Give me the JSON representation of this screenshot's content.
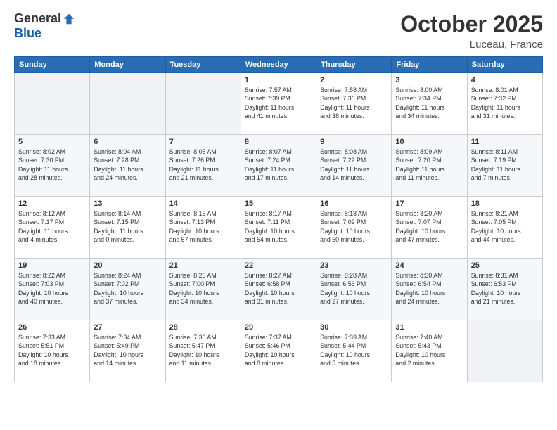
{
  "logo": {
    "general": "General",
    "blue": "Blue"
  },
  "title": "October 2025",
  "location": "Luceau, France",
  "headers": [
    "Sunday",
    "Monday",
    "Tuesday",
    "Wednesday",
    "Thursday",
    "Friday",
    "Saturday"
  ],
  "weeks": [
    [
      {
        "day": "",
        "content": ""
      },
      {
        "day": "",
        "content": ""
      },
      {
        "day": "",
        "content": ""
      },
      {
        "day": "1",
        "content": "Sunrise: 7:57 AM\nSunset: 7:39 PM\nDaylight: 11 hours\nand 41 minutes."
      },
      {
        "day": "2",
        "content": "Sunrise: 7:58 AM\nSunset: 7:36 PM\nDaylight: 11 hours\nand 38 minutes."
      },
      {
        "day": "3",
        "content": "Sunrise: 8:00 AM\nSunset: 7:34 PM\nDaylight: 11 hours\nand 34 minutes."
      },
      {
        "day": "4",
        "content": "Sunrise: 8:01 AM\nSunset: 7:32 PM\nDaylight: 11 hours\nand 31 minutes."
      }
    ],
    [
      {
        "day": "5",
        "content": "Sunrise: 8:02 AM\nSunset: 7:30 PM\nDaylight: 11 hours\nand 28 minutes."
      },
      {
        "day": "6",
        "content": "Sunrise: 8:04 AM\nSunset: 7:28 PM\nDaylight: 11 hours\nand 24 minutes."
      },
      {
        "day": "7",
        "content": "Sunrise: 8:05 AM\nSunset: 7:26 PM\nDaylight: 11 hours\nand 21 minutes."
      },
      {
        "day": "8",
        "content": "Sunrise: 8:07 AM\nSunset: 7:24 PM\nDaylight: 11 hours\nand 17 minutes."
      },
      {
        "day": "9",
        "content": "Sunrise: 8:08 AM\nSunset: 7:22 PM\nDaylight: 11 hours\nand 14 minutes."
      },
      {
        "day": "10",
        "content": "Sunrise: 8:09 AM\nSunset: 7:20 PM\nDaylight: 11 hours\nand 11 minutes."
      },
      {
        "day": "11",
        "content": "Sunrise: 8:11 AM\nSunset: 7:19 PM\nDaylight: 11 hours\nand 7 minutes."
      }
    ],
    [
      {
        "day": "12",
        "content": "Sunrise: 8:12 AM\nSunset: 7:17 PM\nDaylight: 11 hours\nand 4 minutes."
      },
      {
        "day": "13",
        "content": "Sunrise: 8:14 AM\nSunset: 7:15 PM\nDaylight: 11 hours\nand 0 minutes."
      },
      {
        "day": "14",
        "content": "Sunrise: 8:15 AM\nSunset: 7:13 PM\nDaylight: 10 hours\nand 57 minutes."
      },
      {
        "day": "15",
        "content": "Sunrise: 8:17 AM\nSunset: 7:11 PM\nDaylight: 10 hours\nand 54 minutes."
      },
      {
        "day": "16",
        "content": "Sunrise: 8:18 AM\nSunset: 7:09 PM\nDaylight: 10 hours\nand 50 minutes."
      },
      {
        "day": "17",
        "content": "Sunrise: 8:20 AM\nSunset: 7:07 PM\nDaylight: 10 hours\nand 47 minutes."
      },
      {
        "day": "18",
        "content": "Sunrise: 8:21 AM\nSunset: 7:05 PM\nDaylight: 10 hours\nand 44 minutes."
      }
    ],
    [
      {
        "day": "19",
        "content": "Sunrise: 8:22 AM\nSunset: 7:03 PM\nDaylight: 10 hours\nand 40 minutes."
      },
      {
        "day": "20",
        "content": "Sunrise: 8:24 AM\nSunset: 7:02 PM\nDaylight: 10 hours\nand 37 minutes."
      },
      {
        "day": "21",
        "content": "Sunrise: 8:25 AM\nSunset: 7:00 PM\nDaylight: 10 hours\nand 34 minutes."
      },
      {
        "day": "22",
        "content": "Sunrise: 8:27 AM\nSunset: 6:58 PM\nDaylight: 10 hours\nand 31 minutes."
      },
      {
        "day": "23",
        "content": "Sunrise: 8:28 AM\nSunset: 6:56 PM\nDaylight: 10 hours\nand 27 minutes."
      },
      {
        "day": "24",
        "content": "Sunrise: 8:30 AM\nSunset: 6:54 PM\nDaylight: 10 hours\nand 24 minutes."
      },
      {
        "day": "25",
        "content": "Sunrise: 8:31 AM\nSunset: 6:53 PM\nDaylight: 10 hours\nand 21 minutes."
      }
    ],
    [
      {
        "day": "26",
        "content": "Sunrise: 7:33 AM\nSunset: 5:51 PM\nDaylight: 10 hours\nand 18 minutes."
      },
      {
        "day": "27",
        "content": "Sunrise: 7:34 AM\nSunset: 5:49 PM\nDaylight: 10 hours\nand 14 minutes."
      },
      {
        "day": "28",
        "content": "Sunrise: 7:36 AM\nSunset: 5:47 PM\nDaylight: 10 hours\nand 11 minutes."
      },
      {
        "day": "29",
        "content": "Sunrise: 7:37 AM\nSunset: 5:46 PM\nDaylight: 10 hours\nand 8 minutes."
      },
      {
        "day": "30",
        "content": "Sunrise: 7:39 AM\nSunset: 5:44 PM\nDaylight: 10 hours\nand 5 minutes."
      },
      {
        "day": "31",
        "content": "Sunrise: 7:40 AM\nSunset: 5:43 PM\nDaylight: 10 hours\nand 2 minutes."
      },
      {
        "day": "",
        "content": ""
      }
    ]
  ]
}
